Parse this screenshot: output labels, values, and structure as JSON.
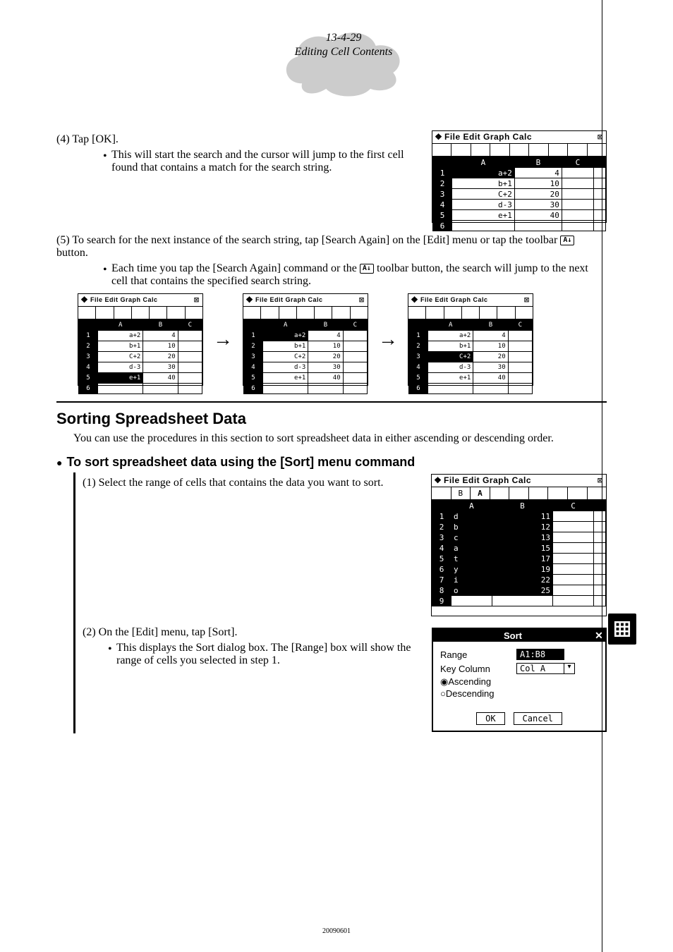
{
  "header": {
    "page_ref": "13-4-29",
    "section": "Editing Cell Contents"
  },
  "step4": {
    "label": "(4) Tap [OK].",
    "bullet": "This will start the search and the cursor will jump to the first cell found that contains a match for the search string."
  },
  "step5": {
    "label": "(5) To search for the next instance of the search string, tap [Search Again] on the [Edit] menu or tap the toolbar ",
    "label2": " button.",
    "bullet_a": "Each time you tap the [Search Again] command or the ",
    "bullet_b": " toolbar button, the search will jump to the next cell that contains the specified search string."
  },
  "toolbar_icon_label": "A↓",
  "titlebar_text": "File Edit Graph Calc",
  "sheet_cols": [
    "A",
    "B",
    "C"
  ],
  "sheet_rows": [
    {
      "r": "1",
      "a": "a+2",
      "b": "4"
    },
    {
      "r": "2",
      "a": "b+1",
      "b": "10"
    },
    {
      "r": "3",
      "a": "C+2",
      "b": "20"
    },
    {
      "r": "4",
      "a": "d-3",
      "b": "30"
    },
    {
      "r": "5",
      "a": "e+1",
      "b": "40"
    },
    {
      "r": "6",
      "a": "",
      "b": ""
    }
  ],
  "highlight_large": {
    "row": 1,
    "col": "a"
  },
  "highlights_seq": [
    {
      "row": 5,
      "col": "a"
    },
    {
      "row": 1,
      "col": "a"
    },
    {
      "row": 3,
      "col": "a"
    }
  ],
  "sorting": {
    "heading": "Sorting Spreadsheet Data",
    "intro": "You can use the procedures in this section to sort spreadsheet data in either ascending or descending order.",
    "sub": "To sort spreadsheet data using the [Sort] menu command",
    "step1": "(1) Select the range of cells that contains the data you want to sort.",
    "step2": "(2) On the [Edit] menu, tap [Sort].",
    "step2_bullet": "This displays the Sort dialog box. The [Range] box will show the range of cells you selected in step 1."
  },
  "sheet2_rows": [
    {
      "r": "1",
      "a": "d",
      "b": "11"
    },
    {
      "r": "2",
      "a": "b",
      "b": "12"
    },
    {
      "r": "3",
      "a": "c",
      "b": "13"
    },
    {
      "r": "4",
      "a": "a",
      "b": "15"
    },
    {
      "r": "5",
      "a": "t",
      "b": "17"
    },
    {
      "r": "6",
      "a": "y",
      "b": "19"
    },
    {
      "r": "7",
      "a": "i",
      "b": "22"
    },
    {
      "r": "8",
      "a": "o",
      "b": "25"
    },
    {
      "r": "9",
      "a": "",
      "b": ""
    }
  ],
  "dialog": {
    "title": "Sort",
    "range_label": "Range",
    "range_value": "A1:B8",
    "key_label": "Key Column",
    "key_value": "Col A",
    "asc": "Ascending",
    "desc": "Descending",
    "ok": "OK",
    "cancel": "Cancel"
  },
  "footer": "20090601"
}
